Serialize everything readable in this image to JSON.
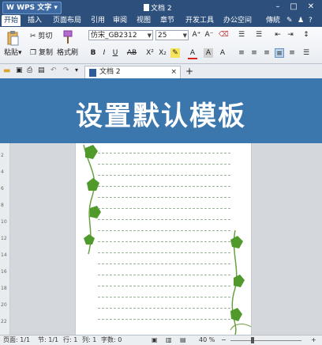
{
  "titlebar": {
    "app_button": "WPS 文字",
    "doc_title": "文档 2",
    "controls": [
      "–",
      "□",
      "✕"
    ]
  },
  "menubar": {
    "items": [
      "开始",
      "插入",
      "页面布局",
      "引用",
      "审阅",
      "视图",
      "章节",
      "开发工具",
      "办公空间"
    ],
    "right_label": "傳統"
  },
  "ribbon": {
    "paste_label": "粘贴",
    "cut_label": "剪切",
    "copy_label": "复制",
    "format_painter_label": "格式刷",
    "font_name": "仿宋_GB2312",
    "font_size": "25"
  },
  "tabbar": {
    "doc_tab_label": "文档 2",
    "new_tab": "+"
  },
  "banner": {
    "text": "设置默认模板"
  },
  "ruler": {
    "numbers": [
      "2",
      "4",
      "6",
      "8",
      "10",
      "12",
      "14",
      "16",
      "18",
      "20",
      "22"
    ]
  },
  "statusbar": {
    "page": "页面: 1/1",
    "section": "节: 1/1",
    "row": "行: 1",
    "col": "列: 1",
    "wordcount": "字数: 0",
    "zoom": "40 %"
  },
  "colors": {
    "titlebar": "#2c4f7c",
    "banner": "#3b76ad",
    "vine_leaf": "#4f9a2a"
  }
}
